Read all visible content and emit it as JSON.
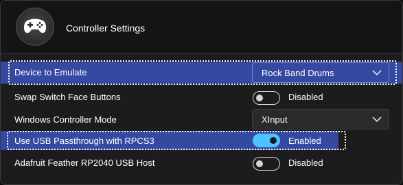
{
  "header": {
    "title": "Controller Settings",
    "logo_icon": "gamepad-icon"
  },
  "settings": [
    {
      "label": "Device to Emulate",
      "control": "select",
      "value": "Rock Band Drums",
      "selected": true
    },
    {
      "label": "Swap Switch Face Buttons",
      "control": "toggle",
      "state": "Disabled",
      "on": false
    },
    {
      "label": "Windows Controller Mode",
      "control": "select",
      "value": "XInput",
      "selected": false
    },
    {
      "label": "Use USB Passthrough with RPCS3",
      "control": "toggle",
      "state": "Enabled",
      "on": true,
      "selected": true
    },
    {
      "label": "Adafruit Feather RP2040 USB Host",
      "control": "toggle",
      "state": "Disabled",
      "on": false
    }
  ],
  "colors": {
    "selection": "#3549a1",
    "toggle_on": "#4cc2ff",
    "background": "#1c1c1c"
  }
}
